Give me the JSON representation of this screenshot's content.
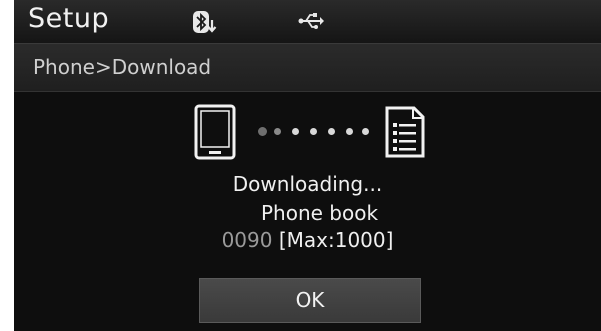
{
  "header": {
    "title": "Setup",
    "icons": [
      "bluetooth-download-icon",
      "usb-icon"
    ]
  },
  "breadcrumb": "Phone>Download",
  "download": {
    "status": "Downloading...",
    "item": "Phone book",
    "count": "0090",
    "max": "[Max:1000]",
    "icons": [
      "phone-icon",
      "progress-dots",
      "document-icon"
    ]
  },
  "actions": {
    "ok_label": "OK"
  },
  "colors": {
    "background": "#0e0e0e",
    "header": "#1f1f1f",
    "text": "#f0f0f0",
    "count": "#9a9a9a",
    "button": "#444444"
  }
}
